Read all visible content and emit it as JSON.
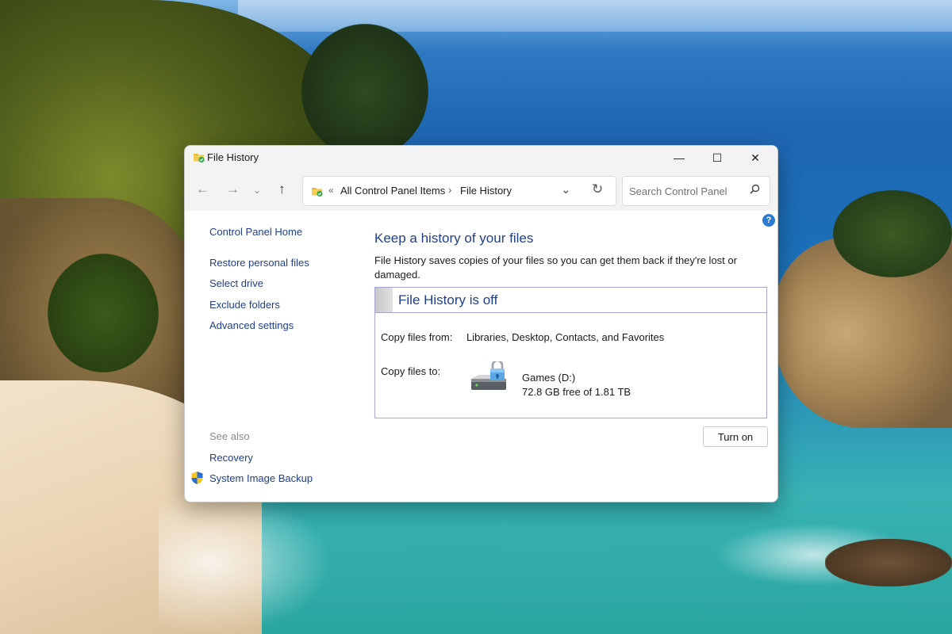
{
  "window": {
    "title": "File History"
  },
  "navigation": {
    "back_glyph": "←",
    "forward_glyph": "→",
    "recent_glyph": "⌄",
    "up_glyph": "↑"
  },
  "address_bar": {
    "overflow_glyph": "«",
    "crumbs": [
      "All Control Panel Items",
      "File History"
    ],
    "separator_glyph": "›",
    "dropdown_glyph": "⌄",
    "refresh_glyph": "↻"
  },
  "search": {
    "placeholder": "Search Control Panel"
  },
  "window_controls": {
    "minimize_glyph": "—",
    "maximize_glyph": "☐",
    "close_glyph": "✕"
  },
  "help": {
    "glyph": "?"
  },
  "left_pane": {
    "home": "Control Panel Home",
    "tasks": [
      "Restore personal files",
      "Select drive",
      "Exclude folders",
      "Advanced settings"
    ],
    "see_also_heading": "See also",
    "see_also": [
      "Recovery",
      "System Image Backup"
    ]
  },
  "content": {
    "heading": "Keep a history of your files",
    "description": "File History saves copies of your files so you can get them back if they're lost or damaged.",
    "status_title": "File History is off",
    "copy_from_label": "Copy files from:",
    "copy_from_value": "Libraries, Desktop, Contacts, and Favorites",
    "copy_to_label": "Copy files to:",
    "drive_name": "Games (D:)",
    "drive_space": "72.8 GB free of 1.81 TB",
    "turn_on_label": "Turn on"
  },
  "icons": {
    "title": "file-history-folder-icon",
    "address": "file-history-folder-icon",
    "search": "search-icon",
    "drive": "hard-drive-lock-icon",
    "shield": "uac-shield-icon"
  },
  "colors": {
    "link": "#1f3f8a",
    "status_border": "#a7a6d3",
    "help_badge": "#2b7cd3"
  }
}
